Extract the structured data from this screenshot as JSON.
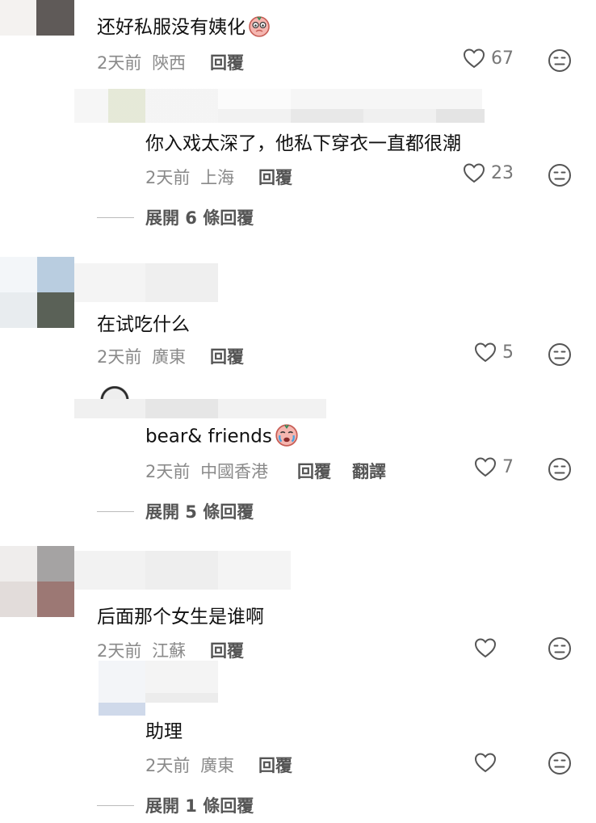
{
  "comments": [
    {
      "text": "还好私服没有姨化",
      "time": "2天前",
      "location": "陝西",
      "reply_label": "回覆",
      "likes": "67",
      "reply": {
        "text": "你入戏太深了，他私下穿衣一直都很潮",
        "time": "2天前",
        "location": "上海",
        "reply_label": "回覆",
        "likes": "23"
      },
      "expand_label": "展開 6 條回覆"
    },
    {
      "text": "在试吃什么",
      "time": "2天前",
      "location": "廣東",
      "reply_label": "回覆",
      "likes": "5",
      "reply": {
        "text": "bear& friends",
        "time": "2天前",
        "location": "中國香港",
        "reply_label": "回覆",
        "translate_label": "翻譯",
        "likes": "7"
      },
      "expand_label": "展開 5 條回覆"
    },
    {
      "text": "后面那个女生是谁啊",
      "time": "2天前",
      "location": "江蘇",
      "reply_label": "回覆",
      "likes": "",
      "reply": {
        "text": "助理",
        "time": "2天前",
        "location": "廣東",
        "reply_label": "回覆",
        "likes": ""
      },
      "expand_label": "展開 1 條回覆"
    }
  ],
  "icons": {
    "like": "heart-outline-icon",
    "react": "neutral-face-icon",
    "sticker": "crying-face-sticker"
  },
  "colors": {
    "text": "#111111",
    "meta": "#8a8a8a",
    "icon": "#555555"
  }
}
